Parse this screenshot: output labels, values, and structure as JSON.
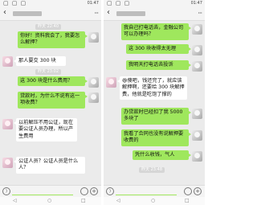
{
  "status": {
    "signal": "▢ ▢ ▢",
    "left_time": "01:47",
    "right_time": "01:47"
  },
  "left": {
    "ts1": "昨天 22:40",
    "ts2": "昨天 23:02",
    "messages": [
      "你好！资料我会了，我要怎么解押？",
      "那人要交 300 块",
      "这 300 块是什么费用？",
      "贷款时，为什么不说有这一项收费？",
      "以前解压不用公证，现在要公证人员办理，所以产生费用",
      "公证人员？公证人员是什么人？"
    ]
  },
  "right": {
    "ts": "昨天 23:48",
    "messages": [
      "我自己打电话去，金融公司可以办理吗？",
      "这 300 块收得太无理",
      "我明天打电话去投诉",
      "😆傻吧，钱还完了，就应该解押啊，还要给 300 块解押费，他就是吃饱了撑的",
      "办贷款时已经扣了我 5000 多块了",
      "我看了合同也没有说解押要收费的",
      "凭什么收钱，气人"
    ]
  },
  "colors": {
    "green_bubble": "#9fe75d",
    "white_bubble": "#ffffff",
    "background": "#ebebeb"
  }
}
